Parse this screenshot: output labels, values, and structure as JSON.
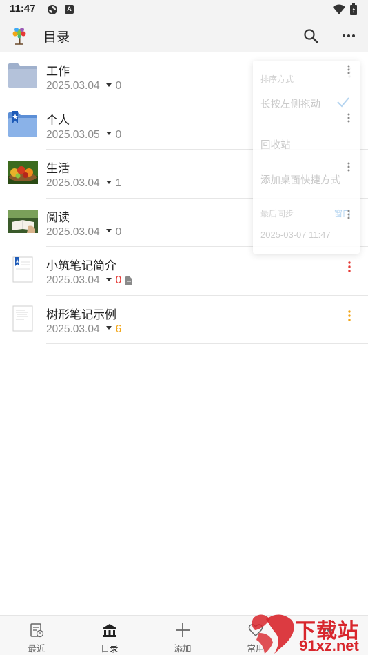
{
  "status_bar": {
    "time": "11:47",
    "badge": "A",
    "icons": [
      "sync-icon",
      "a-badge-icon",
      "wifi-icon",
      "battery-icon"
    ]
  },
  "header": {
    "title": "目录",
    "logo_icon": "tree-logo-icon",
    "actions": [
      "search-icon",
      "more-vert-icon"
    ]
  },
  "items": [
    {
      "name": "工作",
      "date": "2025.03.04",
      "count": "0",
      "count_color": "#8a8a8a",
      "thumb": "folder-icon",
      "menu_color": "#888888"
    },
    {
      "name": "个人",
      "date": "2025.03.05",
      "count": "0",
      "count_color": "#8a8a8a",
      "thumb": "bookmark-folder-icon",
      "menu_color": "#888888"
    },
    {
      "name": "生活",
      "date": "2025.03.04",
      "count": "1",
      "count_color": "#8a8a8a",
      "thumb": "fruit-photo-thumb",
      "menu_color": "#888888"
    },
    {
      "name": "阅读",
      "date": "2025.03.04",
      "count": "0",
      "count_color": "#8a8a8a",
      "thumb": "reading-photo-thumb",
      "menu_color": "#888888"
    },
    {
      "name": "小筑笔记简介",
      "date": "2025.03.04",
      "count": "0",
      "count_color": "#e53935",
      "thumb": "bookmark-document-icon",
      "menu_color": "#e53935",
      "has_doc_icon": true
    },
    {
      "name": "树形笔记示例",
      "date": "2025.03.04",
      "count": "6",
      "count_color": "#f2a516",
      "thumb": "document-icon",
      "menu_color": "#f2a516"
    }
  ],
  "popup_menu": {
    "sort_header": "排序方式",
    "sort_option": "长按左侧拖动",
    "recycle": "回收站",
    "shortcut": "添加桌面快捷方式",
    "sync_header": "最后同步",
    "sync_link": "窗口",
    "sync_time": "2025-03-07 11:47"
  },
  "bottom_nav": {
    "items": [
      {
        "label": "最近",
        "icon": "recent-note-icon"
      },
      {
        "label": "目录",
        "icon": "bank-building-icon"
      },
      {
        "label": "添加",
        "icon": "plus-icon"
      },
      {
        "label": "常用",
        "icon": "heart-icon"
      },
      {
        "label": "",
        "icon": "more-tab-icon"
      }
    ],
    "active_index": 1
  },
  "watermark": {
    "title": "下载站",
    "url": "91xz.net"
  },
  "colors": {
    "bar_bg": "#f3f3f3",
    "accent_red": "#e53935",
    "accent_orange": "#f2a516",
    "watermark_red": "#d8262c"
  }
}
